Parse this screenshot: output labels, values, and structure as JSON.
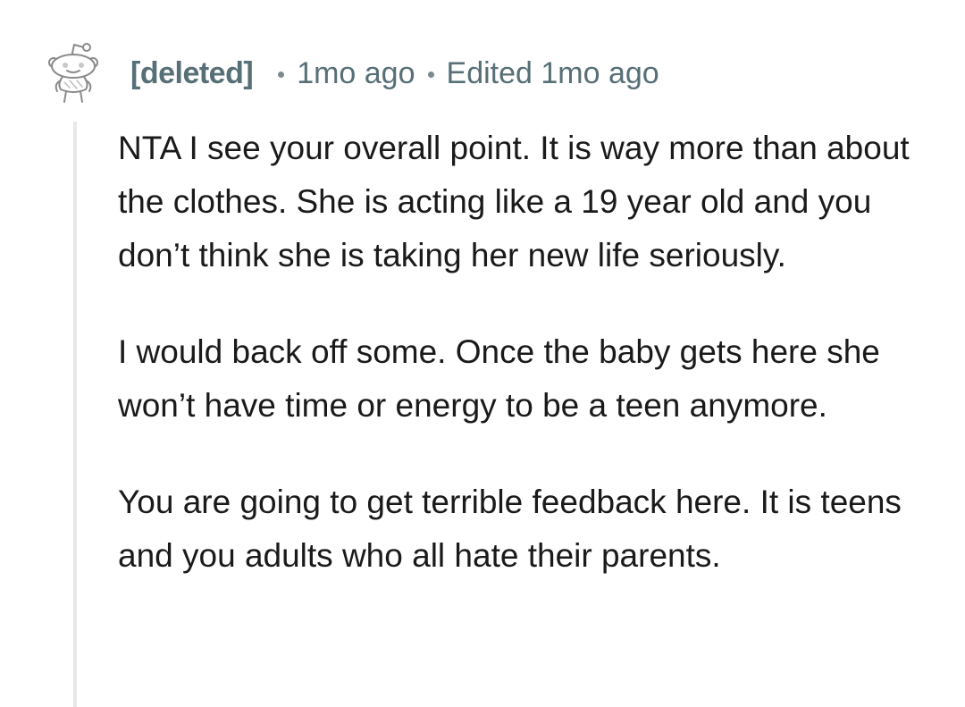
{
  "comment": {
    "author": "[deleted]",
    "timestamp": "1mo ago",
    "edited": "Edited 1mo ago",
    "paragraphs": [
      "NTA I see your overall point. It is way more than about the clothes. She is acting like a 19 year old and you don’t think she is taking her new life seriously.",
      "I would back off some. Once the baby gets here she won’t have time or energy to be a teen anymore.",
      "You are going to get terrible feedback here. It is teens and you adults who all hate their parents."
    ]
  },
  "icons": {
    "avatar": "snoo-avatar-icon"
  },
  "colors": {
    "meta_text": "#576f76",
    "body_text": "#1a1a1b",
    "thread_line": "#e6e8ea"
  }
}
